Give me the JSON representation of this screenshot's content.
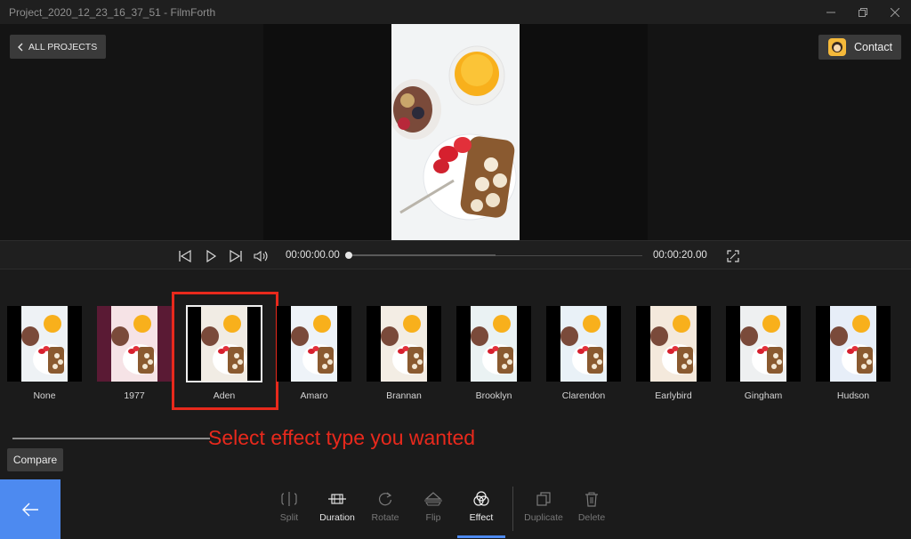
{
  "window": {
    "title": "Project_2020_12_23_16_37_51 - FilmForth",
    "minimize_icon": "minimize-icon",
    "maximize_icon": "restore-icon",
    "close_icon": "close-icon"
  },
  "header": {
    "back_label": "ALL PROJECTS",
    "contact_label": "Contact"
  },
  "player": {
    "current_time": "00:00:00.00",
    "total_time": "00:00:20.00",
    "progress": 0
  },
  "effects": {
    "items": [
      {
        "label": "None",
        "tint": "#eef2f5"
      },
      {
        "label": "1977",
        "tint": "#f6e3e6"
      },
      {
        "label": "Aden",
        "tint": "#f1ece4"
      },
      {
        "label": "Amaro",
        "tint": "#eef3f8"
      },
      {
        "label": "Brannan",
        "tint": "#f3ede4"
      },
      {
        "label": "Brooklyn",
        "tint": "#eaf2f3"
      },
      {
        "label": "Clarendon",
        "tint": "#e9f1f7"
      },
      {
        "label": "Earlybird",
        "tint": "#f4e9dc"
      },
      {
        "label": "Gingham",
        "tint": "#eef0f1"
      },
      {
        "label": "Hudson",
        "tint": "#e7eef8"
      }
    ],
    "selected": "Aden"
  },
  "annotation": "Select effect type you wanted",
  "compare_label": "Compare",
  "toolbar": {
    "items": [
      {
        "label": "Split",
        "icon": "split-icon"
      },
      {
        "label": "Duration",
        "icon": "duration-icon"
      },
      {
        "label": "Rotate",
        "icon": "rotate-icon"
      },
      {
        "label": "Flip",
        "icon": "flip-icon"
      },
      {
        "label": "Effect",
        "icon": "effect-icon"
      },
      {
        "label": "Duplicate",
        "icon": "duplicate-icon"
      },
      {
        "label": "Delete",
        "icon": "delete-icon"
      }
    ],
    "active": "Effect"
  },
  "colors": {
    "accent": "#4d8af0",
    "annotation": "#e8291c"
  }
}
